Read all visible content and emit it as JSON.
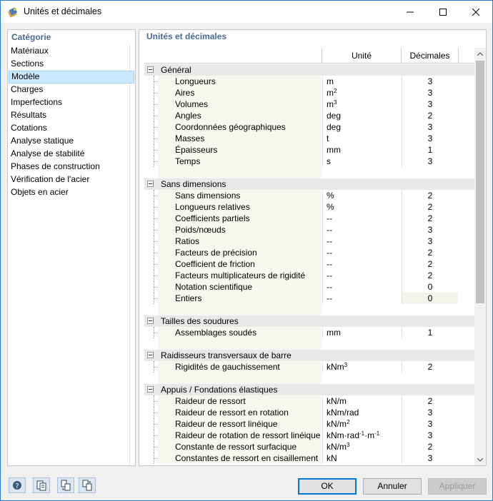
{
  "window": {
    "title": "Unités et décimales"
  },
  "sidebar": {
    "header": "Catégorie",
    "items": [
      {
        "label": "Matériaux"
      },
      {
        "label": "Sections"
      },
      {
        "label": "Modèle",
        "selected": true
      },
      {
        "label": "Charges"
      },
      {
        "label": "Imperfections"
      },
      {
        "label": "Résultats"
      },
      {
        "label": "Cotations"
      },
      {
        "label": "Analyse statique"
      },
      {
        "label": "Analyse de stabilité"
      },
      {
        "label": "Phases de construction"
      },
      {
        "label": "Vérification de l'acier"
      },
      {
        "label": "Objets en acier"
      }
    ]
  },
  "main": {
    "header": "Unités et décimales",
    "columns": {
      "unit": "Unité",
      "decimals": "Décimales"
    },
    "groups": [
      {
        "title": "Général",
        "rows": [
          {
            "name": "Longueurs",
            "unit": "m",
            "dec": "3"
          },
          {
            "name": "Aires",
            "unit": "m",
            "unit_sup": "2",
            "dec": "3"
          },
          {
            "name": "Volumes",
            "unit": "m",
            "unit_sup": "3",
            "dec": "3"
          },
          {
            "name": "Angles",
            "unit": "deg",
            "dec": "2"
          },
          {
            "name": "Coordonnées géographiques",
            "unit": "deg",
            "dec": "3"
          },
          {
            "name": "Masses",
            "unit": "t",
            "dec": "3"
          },
          {
            "name": "Épaisseurs",
            "unit": "mm",
            "dec": "1"
          },
          {
            "name": "Temps",
            "unit": "s",
            "dec": "3"
          }
        ]
      },
      {
        "title": "Sans dimensions",
        "rows": [
          {
            "name": "Sans dimensions",
            "unit": "%",
            "dec": "2"
          },
          {
            "name": "Longueurs relatives",
            "unit": "%",
            "dec": "2"
          },
          {
            "name": "Coefficients partiels",
            "unit": "--",
            "dec": "2"
          },
          {
            "name": "Poids/nœuds",
            "unit": "--",
            "dec": "3"
          },
          {
            "name": "Ratios",
            "unit": "--",
            "dec": "3"
          },
          {
            "name": "Facteurs de précision",
            "unit": "--",
            "dec": "2"
          },
          {
            "name": "Coefficient de friction",
            "unit": "--",
            "dec": "2"
          },
          {
            "name": "Facteurs multiplicateurs de rigidité",
            "unit": "--",
            "dec": "2"
          },
          {
            "name": "Notation scientifique",
            "unit": "--",
            "dec": "0"
          },
          {
            "name": "Entiers",
            "unit": "--",
            "dec": "0",
            "shaded": true
          }
        ]
      },
      {
        "title": "Tailles des soudures",
        "rows": [
          {
            "name": "Assemblages soudés",
            "unit": "mm",
            "dec": "1"
          }
        ]
      },
      {
        "title": "Raidisseurs transversaux de barre",
        "rows": [
          {
            "name": "Rigidités de gauchissement",
            "unit": "kNm",
            "unit_sup": "3",
            "dec": "2"
          }
        ]
      },
      {
        "title": "Appuis / Fondations élastiques",
        "rows": [
          {
            "name": "Raideur de ressort",
            "unit": "kN/m",
            "dec": "2"
          },
          {
            "name": "Raideur de ressort en rotation",
            "unit": "kNm/rad",
            "dec": "3"
          },
          {
            "name": "Raideur de ressort linéique",
            "unit": "kN/m",
            "unit_sup": "2",
            "dec": "3"
          },
          {
            "name": "Raideur de rotation de ressort linéique",
            "unit": "kNm·rad",
            "unit_sup": "-1",
            "unit_tail": "·m",
            "unit_sup2": "-1",
            "dec": "3"
          },
          {
            "name": "Constante de ressort surfacique",
            "unit": "kN/m",
            "unit_sup": "3",
            "dec": "2"
          },
          {
            "name": "Constantes de ressort en cisaillement",
            "unit": "kN",
            "dec": "3"
          }
        ]
      }
    ]
  },
  "buttons": {
    "ok": "OK",
    "cancel": "Annuler",
    "apply": "Appliquer"
  },
  "tools": [
    "help-icon",
    "units-icon",
    "import-icon",
    "export-icon"
  ]
}
